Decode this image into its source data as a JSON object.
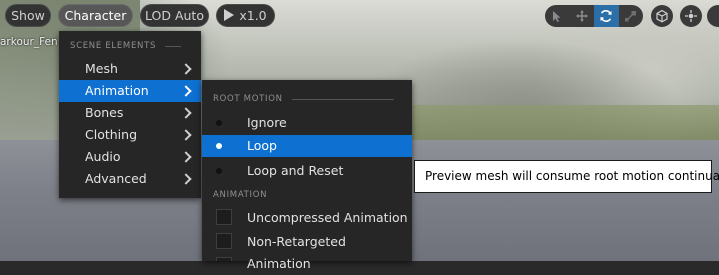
{
  "viewport": {
    "asset_label": "arkour_Fen"
  },
  "toolbar": {
    "show_label": "Show",
    "character_label": "Character",
    "lod_label": "LOD Auto",
    "speed_label": "x1.0",
    "tools": [
      {
        "icon": "select-arrow-icon",
        "selected": false
      },
      {
        "icon": "move-icon",
        "selected": false
      },
      {
        "icon": "rotate-icon",
        "selected": true
      },
      {
        "icon": "scale-icon",
        "selected": false
      }
    ],
    "right_icons": [
      "world-space-icon",
      "surface-snap-icon"
    ]
  },
  "character_menu": {
    "header": "SCENE ELEMENTS",
    "items": [
      {
        "label": "Mesh",
        "submenu": true,
        "highlighted": false
      },
      {
        "label": "Animation",
        "submenu": true,
        "highlighted": true
      },
      {
        "label": "Bones",
        "submenu": true,
        "highlighted": false
      },
      {
        "label": "Clothing",
        "submenu": true,
        "highlighted": false
      },
      {
        "label": "Audio",
        "submenu": true,
        "highlighted": false
      },
      {
        "label": "Advanced",
        "submenu": true,
        "highlighted": false
      }
    ]
  },
  "animation_menu": {
    "root_motion_header": "ROOT MOTION",
    "root_motion_options": [
      {
        "label": "Ignore",
        "selected": false
      },
      {
        "label": "Loop",
        "selected": true
      },
      {
        "label": "Loop and Reset",
        "selected": false
      }
    ],
    "animation_header": "ANIMATION",
    "animation_options": [
      {
        "label": "Uncompressed Animation",
        "checked": false
      },
      {
        "label": "Non-Retargeted Animation",
        "checked": false
      }
    ]
  },
  "tooltip": {
    "text": "Preview mesh will consume root motion continually"
  },
  "colors": {
    "highlight": "#0e70d1",
    "selected_tool": "#2c6ea8",
    "menu_bg": "#262626"
  }
}
